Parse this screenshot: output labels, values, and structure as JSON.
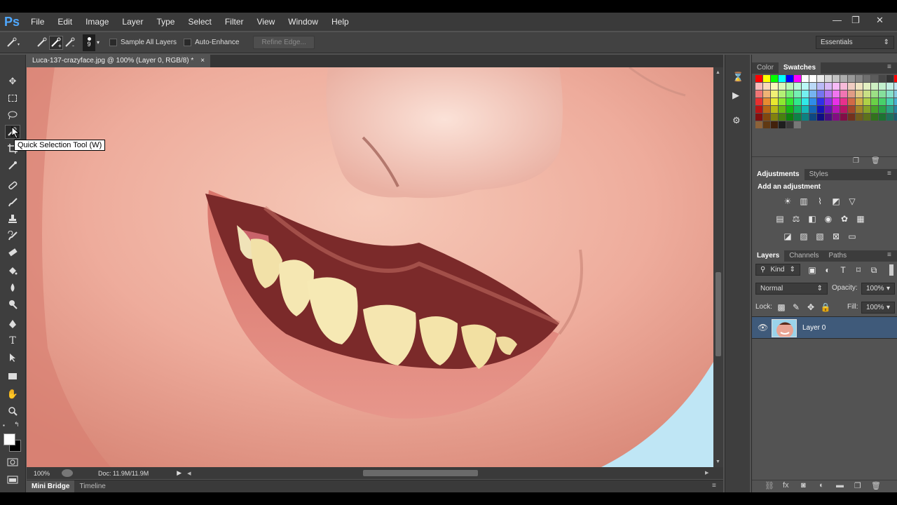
{
  "app": {
    "logo": "Ps",
    "menu": [
      "File",
      "Edit",
      "Image",
      "Layer",
      "Type",
      "Select",
      "Filter",
      "View",
      "Window",
      "Help"
    ],
    "window_controls": [
      "—",
      "❐",
      "✕"
    ]
  },
  "options_bar": {
    "brush_size": "9",
    "sample_all_layers": "Sample All Layers",
    "auto_enhance": "Auto-Enhance",
    "refine_edge": "Refine Edge...",
    "workspace": "Essentials"
  },
  "document": {
    "tab_title": "Luca-137-crazyface.jpg @ 100% (Layer 0, RGB/8) *",
    "close": "×"
  },
  "tooltip": "Quick Selection Tool (W)",
  "status": {
    "zoom": "100%",
    "doc": "Doc: 11.9M/11.9M"
  },
  "bottom_tabs": [
    "Mini Bridge",
    "Timeline"
  ],
  "color_panel": {
    "tabs": [
      "Color",
      "Swatches"
    ],
    "active": "Swatches"
  },
  "adjustments_panel": {
    "tabs": [
      "Adjustments",
      "Styles"
    ],
    "heading": "Add an adjustment"
  },
  "layers_panel": {
    "tabs": [
      "Layers",
      "Channels",
      "Paths"
    ],
    "filter": "Kind",
    "blend_mode": "Normal",
    "opacity_label": "Opacity:",
    "opacity": "100%",
    "lock_label": "Lock:",
    "fill_label": "Fill:",
    "fill": "100%",
    "layers": [
      {
        "name": "Layer 0",
        "visible": true,
        "selected": true
      }
    ]
  },
  "colors": {
    "accent": "#4fa8ff",
    "selected_layer": "#3f5a7a",
    "panel_bg": "#535353",
    "dark_bg": "#3a3a3a"
  }
}
